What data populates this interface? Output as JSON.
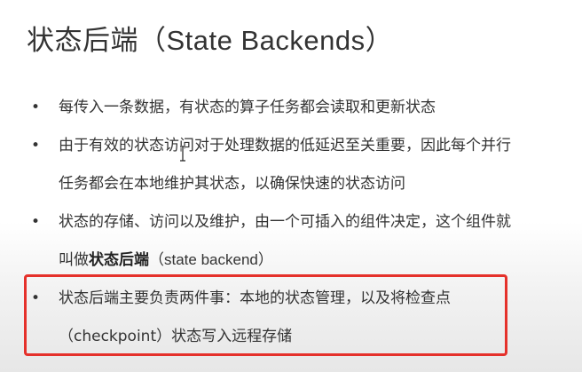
{
  "title": {
    "cn": "状态后端",
    "en": "（State Backends）"
  },
  "bullets": [
    {
      "lines": [
        "每传入一条数据，有状态的算子任务都会读取和更新状态"
      ]
    },
    {
      "lines": [
        "由于有效的状态访问对于处理数据的低延迟至关重要，因此每个并行",
        "任务都会在本地维护其状态，以确保快速的状态访问"
      ]
    },
    {
      "line1": "状态的存储、访问以及维护，由一个可插入的组件决定，这个组件就",
      "line2_prefix": "叫做",
      "line2_bold": "状态后端",
      "line2_suffix": "（state backend）"
    },
    {
      "lines": [
        "状态后端主要负责两件事：本地的状态管理，以及将检查点",
        "（checkpoint）状态写入远程存储"
      ]
    }
  ],
  "bullet_symbol": "•",
  "colors": {
    "text": "#333333",
    "highlight_border": "#e5312b"
  },
  "icons": {
    "cursor": "text-cursor-icon"
  }
}
